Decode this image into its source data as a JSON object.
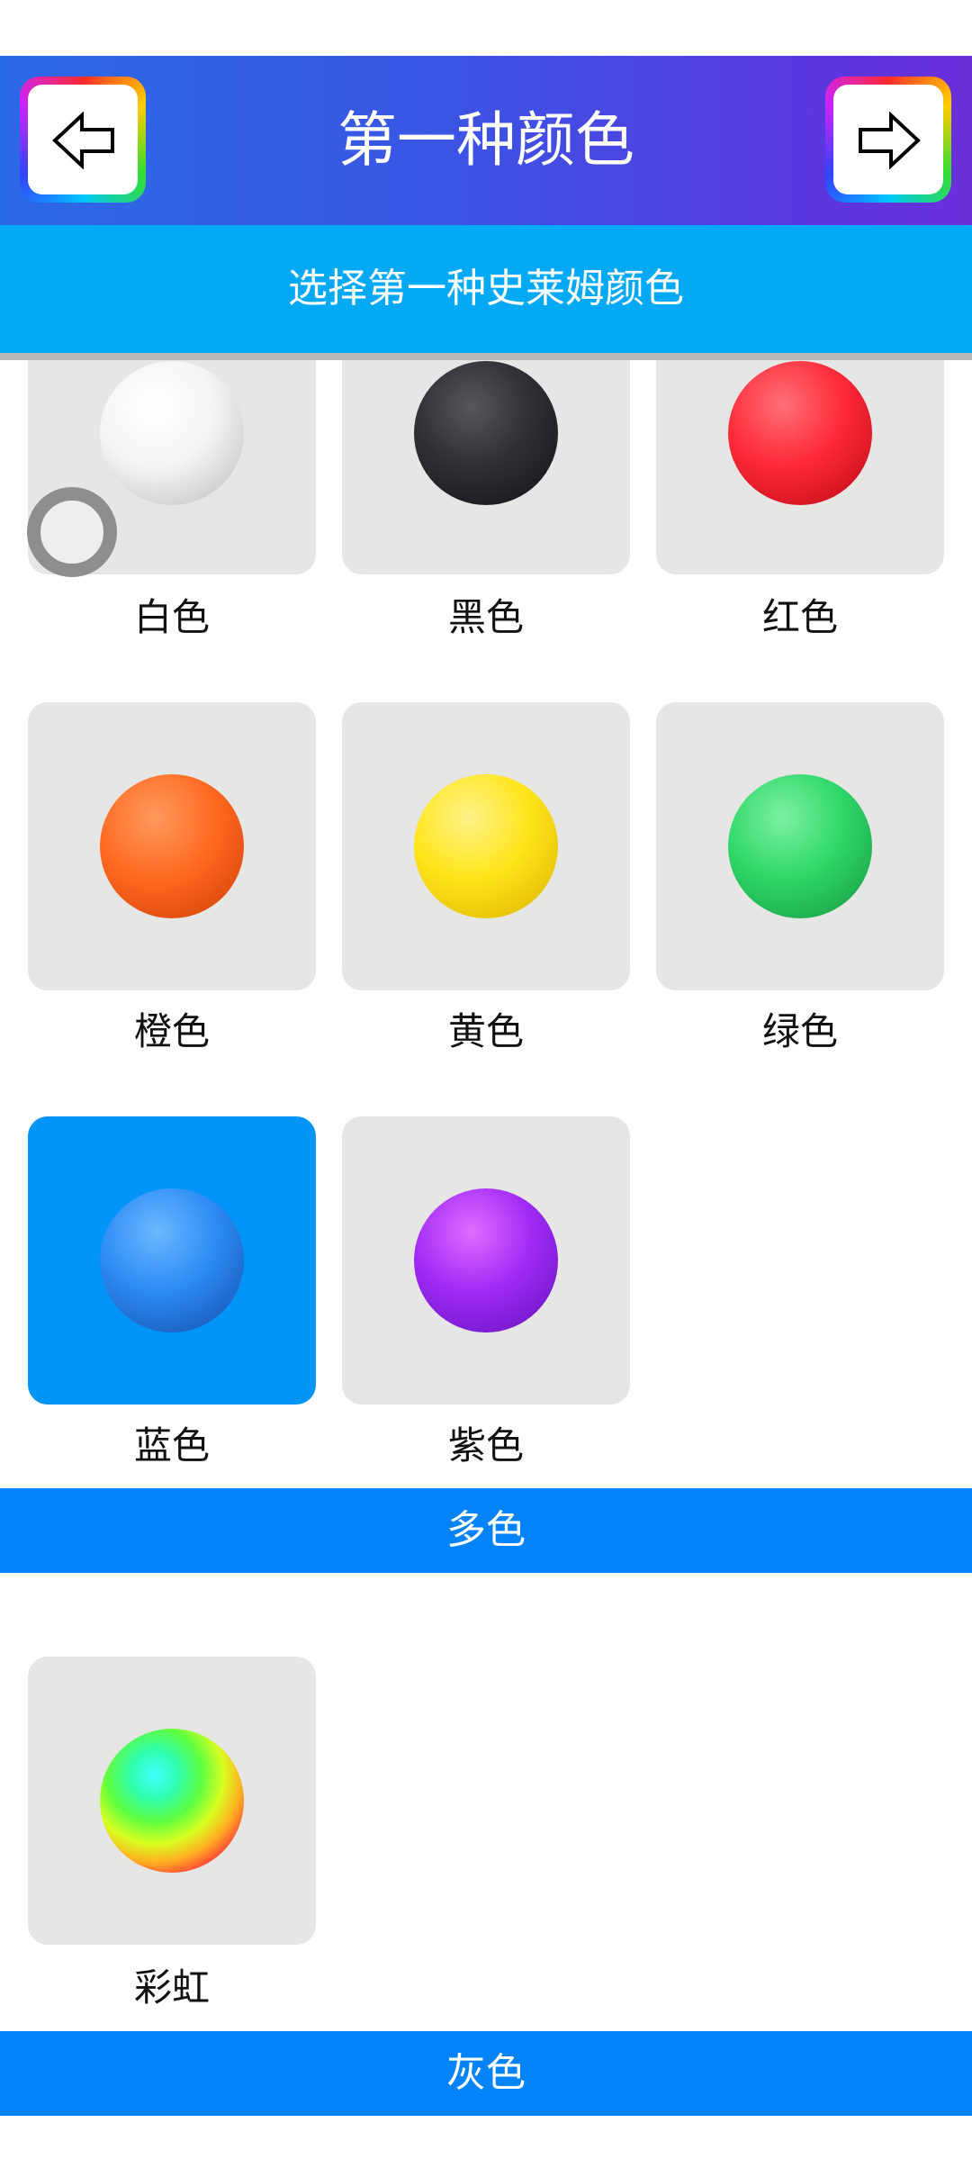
{
  "header": {
    "title": "第一种颜色",
    "back_icon": "arrow-left-icon",
    "next_icon": "arrow-right-icon"
  },
  "subtitle": "选择第一种史莱姆颜色",
  "colors": [
    {
      "label": "白色",
      "ball_color": "#ffffff"
    },
    {
      "label": "黑色",
      "ball_color": "#2a2b2f"
    },
    {
      "label": "红色",
      "ball_color": "#ff2a38"
    },
    {
      "label": "橙色",
      "ball_color": "#ff6a22"
    },
    {
      "label": "黄色",
      "ball_color": "#ffe51a"
    },
    {
      "label": "绿色",
      "ball_color": "#2fd86a"
    },
    {
      "label": "蓝色",
      "ball_color": "#2d8bf5",
      "selected": true
    },
    {
      "label": "紫色",
      "ball_color": "#a02cf5"
    }
  ],
  "sections": {
    "multicolor": {
      "title": "多色",
      "items": [
        {
          "label": "彩虹",
          "ball_color": "rainbow"
        }
      ]
    },
    "gray": {
      "title": "灰色"
    }
  },
  "theme": {
    "header_gradient": [
      "#2b6ae6",
      "#6a2fd9"
    ],
    "subtitle_bg": "#03a9f4",
    "section_bg": "#0383fa",
    "selected_bg": "#0394fa",
    "card_bg": "#e6e6e4"
  }
}
